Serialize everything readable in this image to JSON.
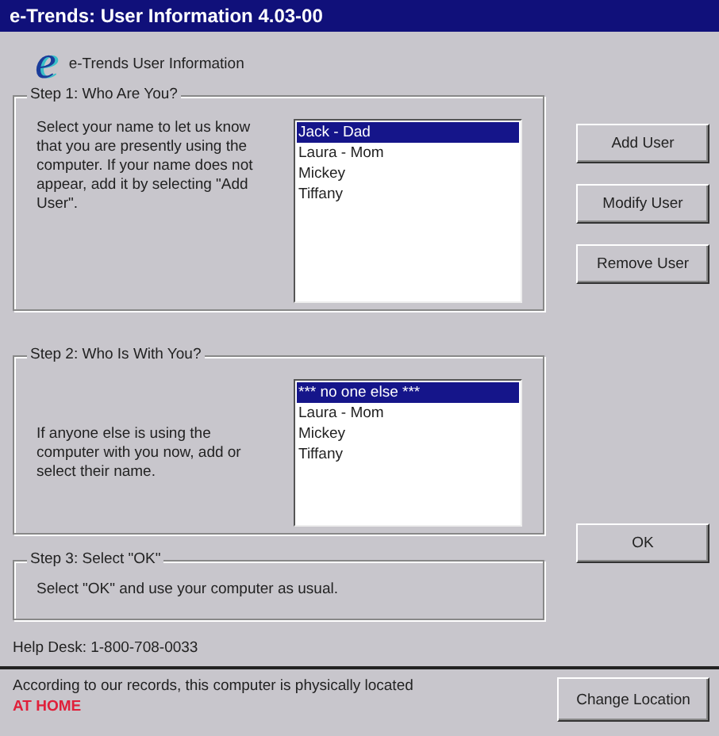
{
  "window": {
    "title": "e-Trends: User Information  4.03-00"
  },
  "header": {
    "logo": "e",
    "title": "e-Trends User Information"
  },
  "step1": {
    "legend": "Step 1:  Who Are You?",
    "text": "Select your name to let us know that you are presently using the computer.  If your name does not appear, add it by selecting \"Add User\".",
    "items": [
      {
        "label": "Jack - Dad",
        "selected": true
      },
      {
        "label": "Laura - Mom",
        "selected": false
      },
      {
        "label": "Mickey",
        "selected": false
      },
      {
        "label": "Tiffany",
        "selected": false
      }
    ]
  },
  "user_buttons": [
    "Add User",
    "Modify User",
    "Remove User"
  ],
  "step2": {
    "legend": "Step 2:  Who Is With You?",
    "text": "If anyone else is using the computer with you now, add or select their name.",
    "items": [
      {
        "label": "*** no one else ***",
        "selected": true
      },
      {
        "label": "Laura - Mom",
        "selected": false
      },
      {
        "label": "Mickey",
        "selected": false
      },
      {
        "label": "Tiffany",
        "selected": false
      }
    ]
  },
  "step3": {
    "legend": "Step 3:  Select \"OK\"",
    "text": "Select \"OK\" and use your computer as usual."
  },
  "ok_button": "OK",
  "help_desk": "Help Desk: 1-800-708-0033",
  "location": {
    "text": "According to our records, this computer is physically located",
    "place": "AT HOME",
    "button": "Change Location"
  }
}
